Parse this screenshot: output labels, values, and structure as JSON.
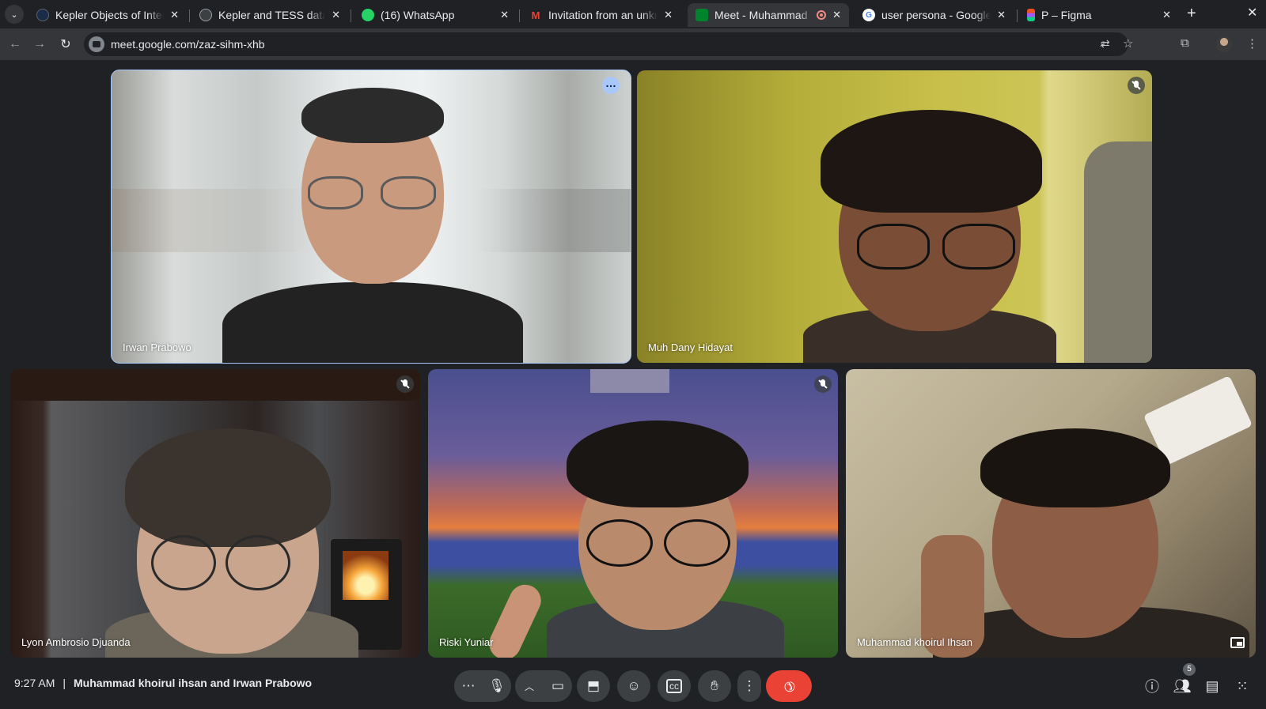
{
  "browser": {
    "tabs": [
      {
        "title": "Kepler Objects of Interest",
        "favicon": "globe-dark-icon",
        "active": false
      },
      {
        "title": "Kepler and TESS datasets",
        "favicon": "globe-icon",
        "active": false
      },
      {
        "title": "(16) WhatsApp",
        "favicon": "whatsapp-icon",
        "active": false
      },
      {
        "title": "Invitation from an unknown",
        "favicon": "gmail-icon",
        "active": false
      },
      {
        "title": "Meet - Muhammad",
        "favicon": "meet-icon",
        "active": true
      },
      {
        "title": "user persona - Google",
        "favicon": "google-icon",
        "active": false
      },
      {
        "title": "P – Figma",
        "favicon": "figma-icon",
        "active": false
      }
    ],
    "url": "meet.google.com/zaz-sihm-xhb",
    "colors": {
      "frame": "#202124",
      "toolbar": "#35363a",
      "omnibox": "#202124",
      "highlight": "#a8c7fa",
      "end_call": "#ea4335"
    }
  },
  "meet": {
    "participants": [
      {
        "name": "Irwan Prabowo",
        "muted": false,
        "speaking": true
      },
      {
        "name": "Muh Dany Hidayat",
        "muted": true,
        "speaking": false
      },
      {
        "name": "Lyon Ambrosio Djuanda",
        "muted": true,
        "speaking": false
      },
      {
        "name": "Riski Yuniar",
        "muted": true,
        "speaking": false
      },
      {
        "name": "Muhammad khoirul Ihsan",
        "muted": false,
        "speaking": false
      }
    ],
    "bottom_bar": {
      "time": "9:27 AM",
      "separator": "|",
      "meeting_title": "Muhammad khoirul ihsan and Irwan Prabowo",
      "people_count": "5"
    }
  }
}
